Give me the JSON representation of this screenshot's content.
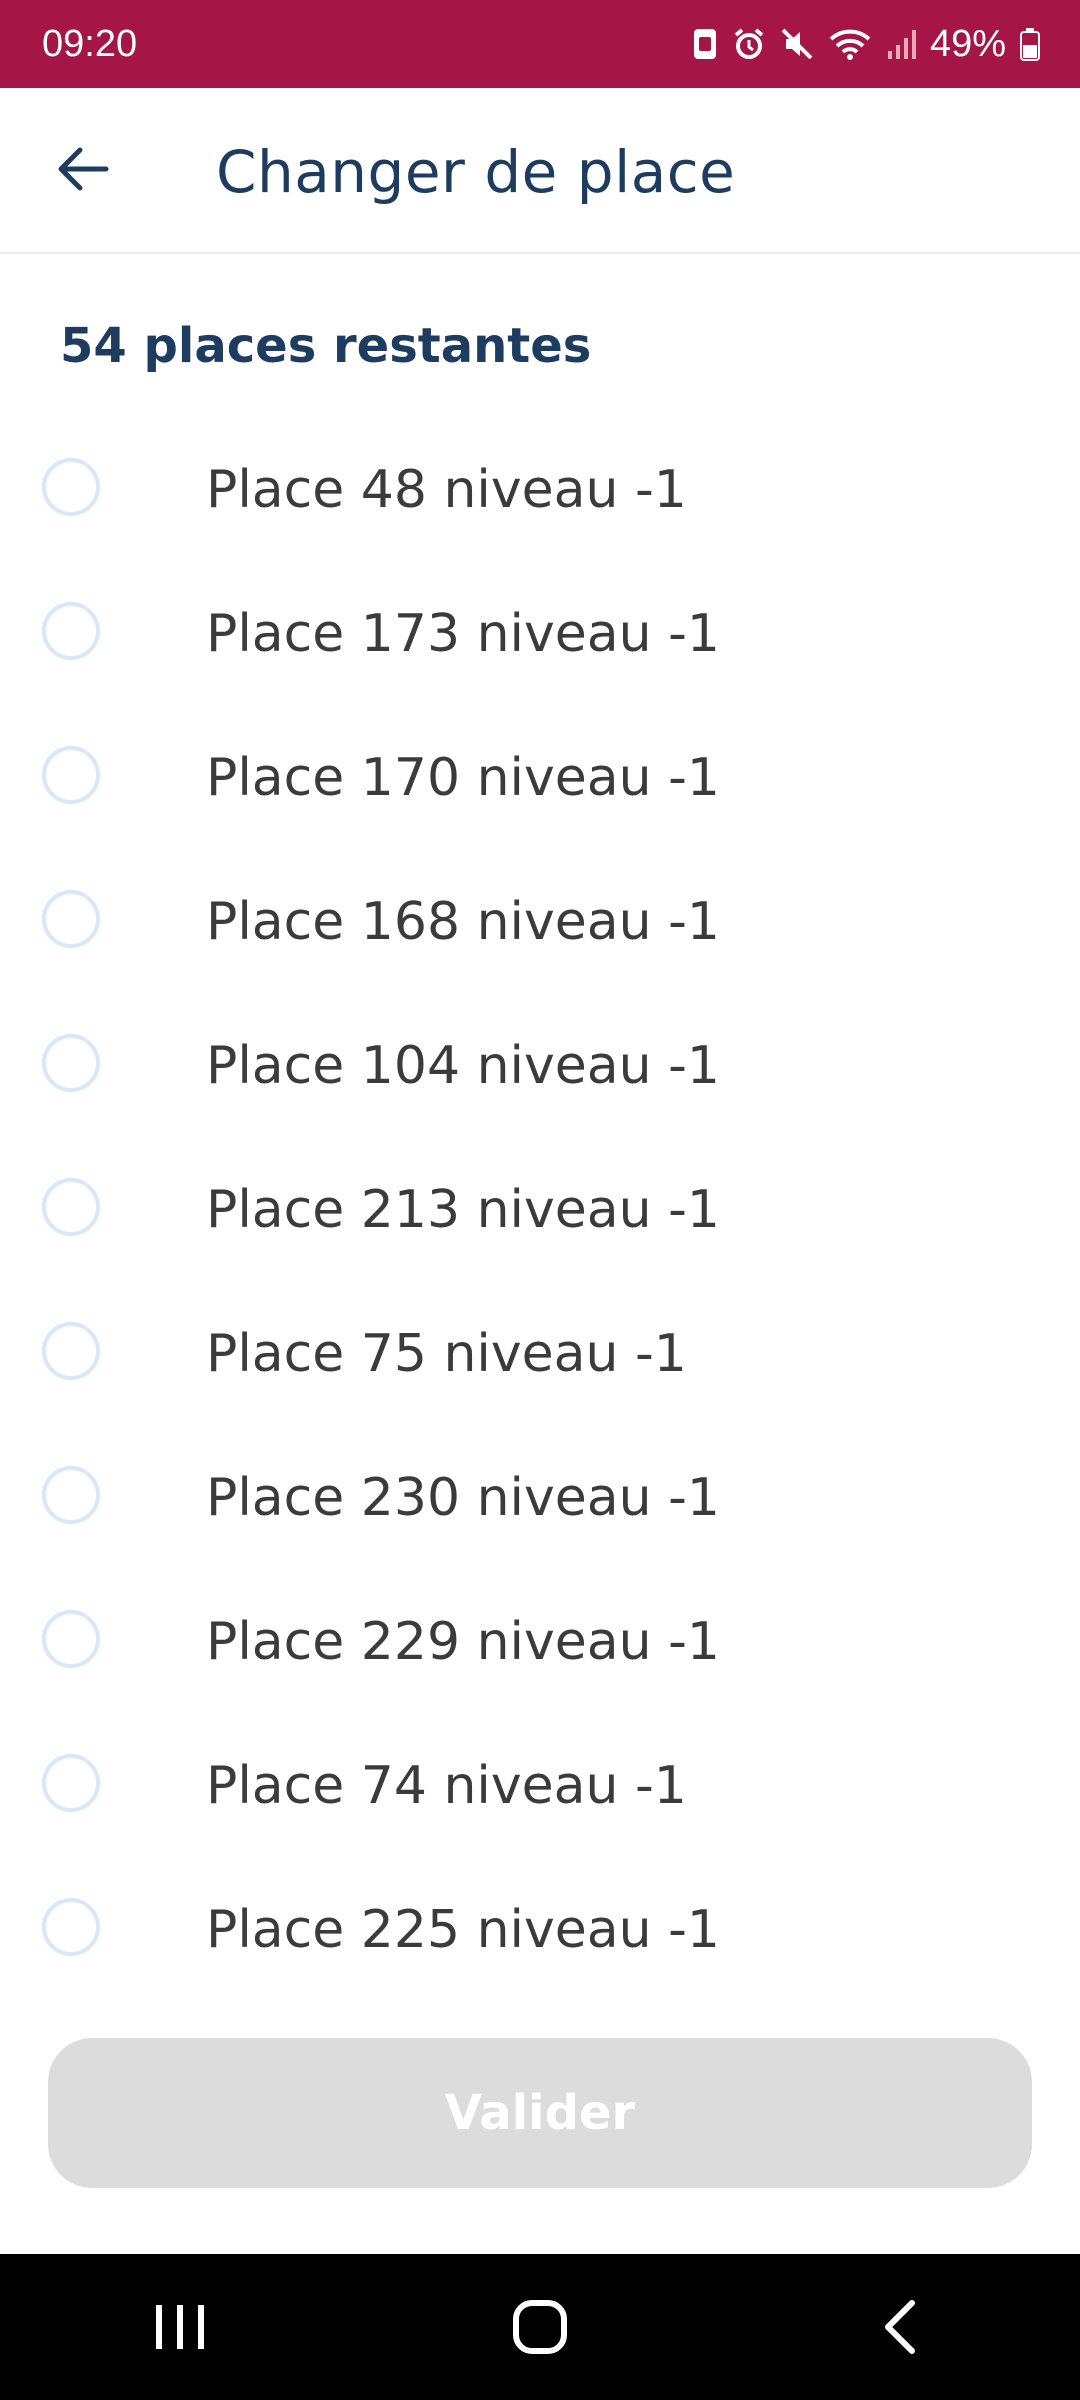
{
  "status_bar": {
    "time": "09:20",
    "battery": "49%",
    "icons": [
      "sim-icon",
      "alarm-icon",
      "mute-icon",
      "wifi-icon",
      "signal-icon",
      "battery-icon"
    ]
  },
  "header": {
    "title": "Changer de place",
    "back_icon": "arrow-left-icon"
  },
  "content": {
    "remaining_text": "54 places restantes",
    "places": [
      {
        "label": "Place 48 niveau -1",
        "selected": false
      },
      {
        "label": "Place 173 niveau -1",
        "selected": false
      },
      {
        "label": "Place 170 niveau -1",
        "selected": false
      },
      {
        "label": "Place 168 niveau -1",
        "selected": false
      },
      {
        "label": "Place 104 niveau -1",
        "selected": false
      },
      {
        "label": "Place 213 niveau -1",
        "selected": false
      },
      {
        "label": "Place 75 niveau -1",
        "selected": false
      },
      {
        "label": "Place 230 niveau -1",
        "selected": false
      },
      {
        "label": "Place 229 niveau -1",
        "selected": false
      },
      {
        "label": "Place 74 niveau -1",
        "selected": false
      },
      {
        "label": "Place 225 niveau -1",
        "selected": false
      }
    ]
  },
  "footer": {
    "validate_label": "Valider",
    "validate_enabled": false
  },
  "colors": {
    "status_bar": "#a51545",
    "primary_text": "#1d3c5f",
    "radio_border": "#d5e9f7",
    "button_disabled": "#dcdcdc"
  }
}
